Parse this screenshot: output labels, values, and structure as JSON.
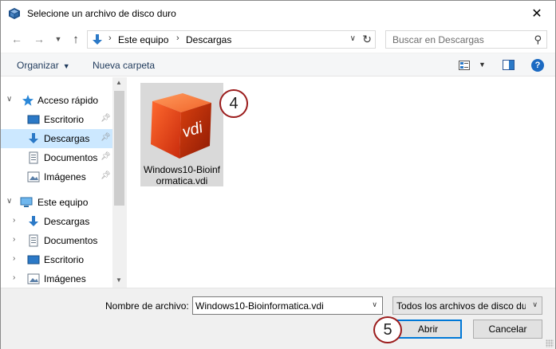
{
  "window": {
    "title": "Selecione un archivo de disco duro",
    "app_icon": "virtualbox-icon",
    "close_icon": "close-icon"
  },
  "navigation": {
    "back_icon": "back-arrow-icon",
    "forward_icon": "forward-arrow-icon",
    "recent_icon": "chevron-down-icon",
    "up_icon": "up-arrow-icon",
    "address": {
      "location_icon": "downloads-icon",
      "breadcrumb": [
        "Este equipo",
        "Descargas"
      ]
    },
    "search_placeholder": "Buscar en Descargas"
  },
  "toolbar": {
    "organize_label": "Organizar",
    "new_folder_label": "Nueva carpeta"
  },
  "sidebar": {
    "groups": [
      {
        "label": "Acceso rápido",
        "icon": "star-icon",
        "expanded": true,
        "items": [
          {
            "label": "Escritorio",
            "icon": "desktop-icon",
            "pinned": true
          },
          {
            "label": "Descargas",
            "icon": "downloads-icon",
            "pinned": true,
            "selected": true
          },
          {
            "label": "Documentos",
            "icon": "documents-icon",
            "pinned": true
          },
          {
            "label": "Imágenes",
            "icon": "pictures-icon",
            "pinned": true
          }
        ]
      },
      {
        "label": "Este equipo",
        "icon": "computer-icon",
        "expanded": true,
        "items": [
          {
            "label": "Descargas",
            "icon": "downloads-icon"
          },
          {
            "label": "Documentos",
            "icon": "documents-icon"
          },
          {
            "label": "Escritorio",
            "icon": "desktop-icon"
          },
          {
            "label": "Imágenes",
            "icon": "pictures-icon"
          }
        ]
      }
    ]
  },
  "files": [
    {
      "name": "Windows10-Bioinformatica.vdi",
      "icon": "vdi-file-icon",
      "icon_text": "vdi",
      "selected": true
    }
  ],
  "annotations": {
    "step_4": "4",
    "step_5": "5"
  },
  "bottom": {
    "file_name_label": "Nombre de archivo:",
    "file_name_value": "Windows10-Bioinformatica.vdi",
    "file_type_value": "Todos los archivos de disco duro",
    "open_label": "Abrir",
    "cancel_label": "Cancelar"
  },
  "colors": {
    "selection": "#cce8ff",
    "accent": "#0078d7",
    "annotation": "#9b1c1c",
    "vdi_orange": "#e8501e"
  }
}
